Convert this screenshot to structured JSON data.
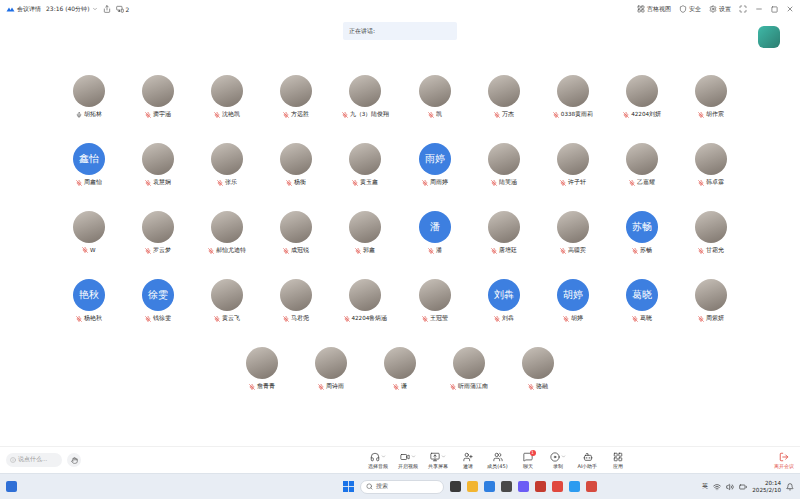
{
  "topbar": {
    "title": "会议详情",
    "duration": "23:16 (40分钟)",
    "screens": "2",
    "view": "宫格视图",
    "security": "安全",
    "settings": "设置"
  },
  "speaking": {
    "label": "正在讲话:"
  },
  "participants": [
    {
      "name": "胡拓林",
      "avatar": {
        "kind": "photo"
      },
      "muted": false
    },
    {
      "name": "龚宇涵",
      "avatar": {
        "kind": "photo"
      },
      "muted": true
    },
    {
      "name": "沈艳凯",
      "avatar": {
        "kind": "photo"
      },
      "muted": true
    },
    {
      "name": "方远胜",
      "avatar": {
        "kind": "photo"
      },
      "muted": true
    },
    {
      "name": "九（3）陆俊翔",
      "avatar": {
        "kind": "photo"
      },
      "muted": true
    },
    {
      "name": "凯",
      "avatar": {
        "kind": "photo"
      },
      "muted": true
    },
    {
      "name": "万杰",
      "avatar": {
        "kind": "photo"
      },
      "muted": true
    },
    {
      "name": "0338黄雨莉",
      "avatar": {
        "kind": "photo"
      },
      "muted": true
    },
    {
      "name": "42204刘妍",
      "avatar": {
        "kind": "photo"
      },
      "muted": true
    },
    {
      "name": "胡作宸",
      "avatar": {
        "kind": "photo"
      },
      "muted": true
    },
    {
      "name": "周鑫怡",
      "avatar": {
        "kind": "text",
        "text": "鑫怡"
      },
      "muted": true
    },
    {
      "name": "袁慧娴",
      "avatar": {
        "kind": "photo"
      },
      "muted": true
    },
    {
      "name": "张乐",
      "avatar": {
        "kind": "photo"
      },
      "muted": true
    },
    {
      "name": "杨衡",
      "avatar": {
        "kind": "photo"
      },
      "muted": true
    },
    {
      "name": "黄玉鑫",
      "avatar": {
        "kind": "photo"
      },
      "muted": true
    },
    {
      "name": "周雨婷",
      "avatar": {
        "kind": "text",
        "text": "雨婷"
      },
      "muted": true
    },
    {
      "name": "陆芙涵",
      "avatar": {
        "kind": "photo"
      },
      "muted": true
    },
    {
      "name": "许子轩",
      "avatar": {
        "kind": "photo"
      },
      "muted": true
    },
    {
      "name": "乙嘉耀",
      "avatar": {
        "kind": "photo"
      },
      "muted": true
    },
    {
      "name": "韩卓霖",
      "avatar": {
        "kind": "photo"
      },
      "muted": true
    },
    {
      "name": "W",
      "avatar": {
        "kind": "photo"
      },
      "muted": true
    },
    {
      "name": "罗云梦",
      "avatar": {
        "kind": "photo"
      },
      "muted": true
    },
    {
      "name": "郝怡尤迪特",
      "avatar": {
        "kind": "photo"
      },
      "muted": true
    },
    {
      "name": "成冠锐",
      "avatar": {
        "kind": "photo"
      },
      "muted": true
    },
    {
      "name": "郭鑫",
      "avatar": {
        "kind": "photo"
      },
      "muted": true
    },
    {
      "name": "潘",
      "avatar": {
        "kind": "text",
        "text": "潘"
      },
      "muted": true
    },
    {
      "name": "唐培廷",
      "avatar": {
        "kind": "photo"
      },
      "muted": true
    },
    {
      "name": "高疆宾",
      "avatar": {
        "kind": "photo"
      },
      "muted": true
    },
    {
      "name": "苏畅",
      "avatar": {
        "kind": "text",
        "text": "苏畅"
      },
      "muted": true
    },
    {
      "name": "甘霜光",
      "avatar": {
        "kind": "photo"
      },
      "muted": true
    },
    {
      "name": "杨艳秋",
      "avatar": {
        "kind": "text",
        "text": "艳秋"
      },
      "muted": true
    },
    {
      "name": "钱徐雯",
      "avatar": {
        "kind": "text",
        "text": "徐雯"
      },
      "muted": true
    },
    {
      "name": "黄云飞",
      "avatar": {
        "kind": "photo"
      },
      "muted": true
    },
    {
      "name": "马君尧",
      "avatar": {
        "kind": "photo"
      },
      "muted": true
    },
    {
      "name": "42204鲁炳涵",
      "avatar": {
        "kind": "photo"
      },
      "muted": true
    },
    {
      "name": "王冠莹",
      "avatar": {
        "kind": "photo"
      },
      "muted": true
    },
    {
      "name": "刘犇",
      "avatar": {
        "kind": "text",
        "text": "刘犇"
      },
      "muted": true
    },
    {
      "name": "胡婷",
      "avatar": {
        "kind": "text",
        "text": "胡婷"
      },
      "muted": true
    },
    {
      "name": "葛晓",
      "avatar": {
        "kind": "text",
        "text": "葛晓"
      },
      "muted": true
    },
    {
      "name": "周紫妍",
      "avatar": {
        "kind": "photo"
      },
      "muted": true
    },
    {
      "name": "詹青青",
      "avatar": {
        "kind": "photo"
      },
      "muted": true
    },
    {
      "name": "周诗雨",
      "avatar": {
        "kind": "photo"
      },
      "muted": true
    },
    {
      "name": "谦",
      "avatar": {
        "kind": "photo"
      },
      "muted": true
    },
    {
      "name": "听雨蒲江南",
      "avatar": {
        "kind": "photo"
      },
      "muted": true
    },
    {
      "name": "骆融",
      "avatar": {
        "kind": "photo"
      },
      "muted": true
    }
  ],
  "chat_input": {
    "placeholder": "说点什么..."
  },
  "toolbar": [
    {
      "label": "选择音频",
      "caret": true
    },
    {
      "label": "开启视频",
      "caret": true
    },
    {
      "label": "共享屏幕",
      "caret": true
    },
    {
      "label": "邀请",
      "caret": false
    },
    {
      "label": "成员(45)",
      "caret": false
    },
    {
      "label": "聊天",
      "caret": false,
      "badge": "1"
    },
    {
      "label": "录制",
      "caret": true
    },
    {
      "label": "AI小助手",
      "caret": false
    },
    {
      "label": "应用",
      "caret": false
    }
  ],
  "leave": {
    "label": "离开会议"
  },
  "taskbar": {
    "search": "搜索",
    "ime": "英",
    "time": "20:14",
    "date": "2025/2/10"
  }
}
